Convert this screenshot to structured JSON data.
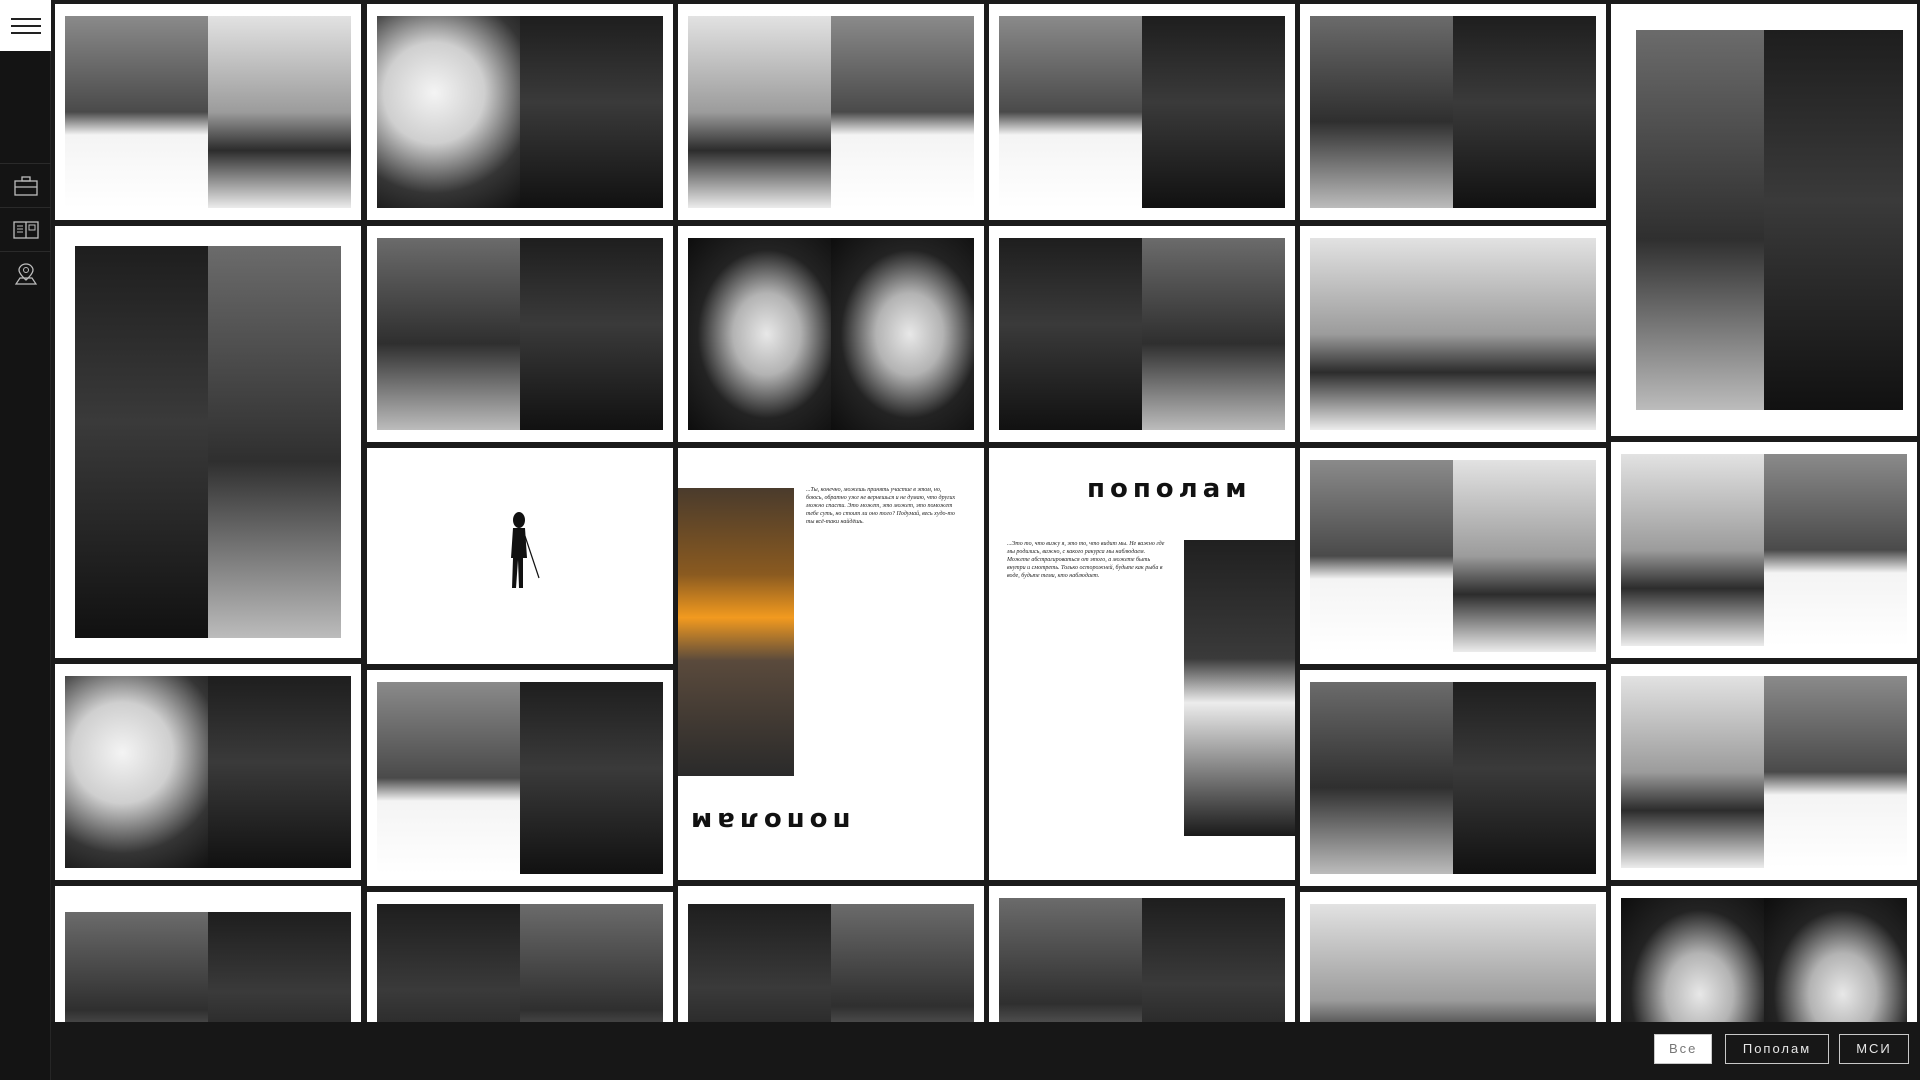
{
  "sidebar": {
    "menu_icon": "hamburger-menu-icon",
    "items": [
      {
        "name": "briefcase-icon"
      },
      {
        "name": "newspaper-icon"
      },
      {
        "name": "map-pin-icon"
      }
    ]
  },
  "book": {
    "title": "пополам",
    "title_flipped": "пополам",
    "quote_left": "...Ты, конечно, можешь принять участие в этом, но, боюсь, обратно уже не вернешься и не думаю, что других можно спасти. Это может, это может, это поможет тебе суть, но стоит ли оно того? Подумай, весь худо-то ты всё-таки найдёшь.",
    "quote_right": "...Это то, что вижу я, это то, что видит мы. Не важно где мы родились, важно, с какого ракурса мы наблюдаем. Можете абстрагироваться от этого, а можете быть внутри и смотреть. Только осторожней, будьте как рыба в воде, будьте теми, кто наблюдает."
  },
  "filters": [
    {
      "label": "Все",
      "active": true
    },
    {
      "label": "Пополам",
      "active": false
    },
    {
      "label": "МСИ",
      "active": false
    }
  ],
  "colors": {
    "background": "#1b1b1b",
    "sidebar": "#141414",
    "tile": "#ffffff",
    "filter_active_bg": "#ffffff",
    "filter_border": "#c8c8c8"
  }
}
